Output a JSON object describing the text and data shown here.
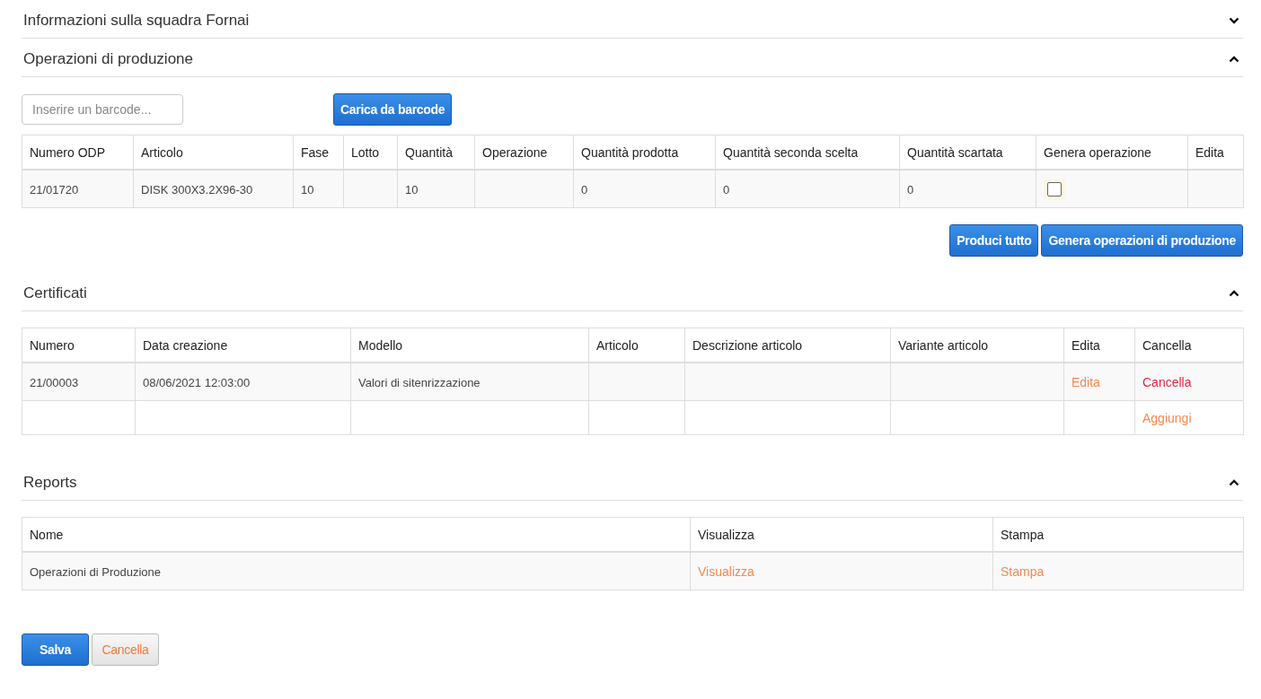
{
  "sections": [
    {
      "title": "Informazioni sulla squadra Fornai",
      "expanded": false
    },
    {
      "title": "Operazioni di produzione",
      "expanded": true,
      "barcode": {
        "placeholder": "Inserire un barcode...",
        "button": "Carica da barcode"
      },
      "table": {
        "columns": [
          "Numero ODP",
          "Articolo",
          "Fase",
          "Lotto",
          "Quantità",
          "Operazione",
          "Quantità prodotta",
          "Quantità seconda scelta",
          "Quantità scartata",
          "Genera operazione",
          "Edita"
        ],
        "rows": [
          [
            "21/01720",
            "DISK 300X3.2X96-30",
            "10",
            null,
            "10",
            null,
            "0",
            "0",
            "0",
            {
              "kind": "checkbox",
              "checked": false
            },
            null
          ]
        ]
      },
      "actions": [
        "Produci tutto",
        "Genera operazioni di produzione"
      ]
    },
    {
      "title": "Certificati",
      "expanded": true,
      "table": {
        "columns": [
          "Numero",
          "Data creazione",
          "Modello",
          "Articolo",
          "Descrizione articolo",
          "Variante articolo",
          "Edita",
          "Cancella"
        ],
        "rows": [
          [
            "21/00003",
            "08/06/2021 12:03:00",
            "Valori di sitenrizzazione",
            null,
            null,
            null,
            {
              "kind": "link",
              "text": "Edita"
            },
            {
              "kind": "danger",
              "text": "Cancella"
            }
          ],
          [
            null,
            null,
            null,
            null,
            null,
            null,
            null,
            {
              "kind": "link",
              "text": "Aggiungi"
            }
          ]
        ]
      }
    },
    {
      "title": "Reports",
      "expanded": true,
      "table": {
        "columns": [
          "Nome",
          "Visualizza",
          "Stampa"
        ],
        "rows": [
          [
            "Operazioni di Produzione",
            {
              "kind": "link",
              "text": "Visualizza"
            },
            {
              "kind": "link",
              "text": "Stampa"
            }
          ]
        ]
      }
    }
  ],
  "footer": {
    "save": "Salva",
    "cancel": "Cancella"
  }
}
